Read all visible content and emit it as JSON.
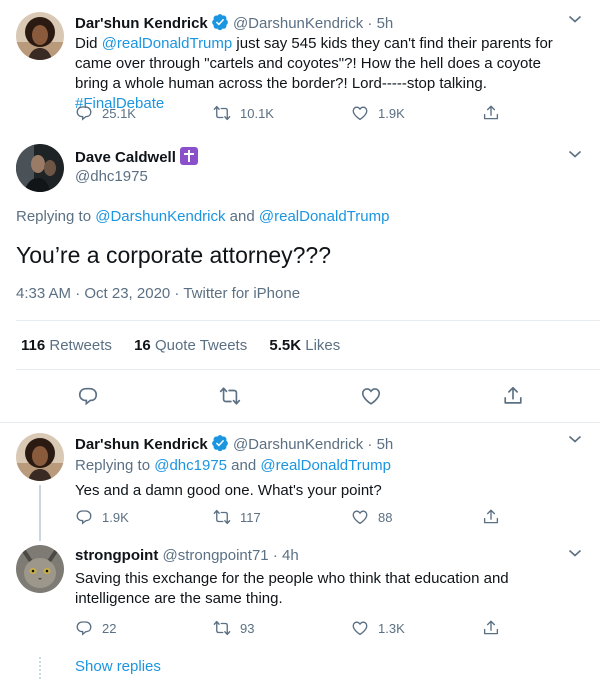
{
  "colors": {
    "link": "#1b95e0",
    "muted": "#5b7083",
    "text": "#0f1419",
    "divider": "#e6ecf0"
  },
  "tweet1": {
    "name": "Dar'shun Kendrick",
    "handle": "@DarshunKendrick",
    "time": "· 5h",
    "text_pre": "Did ",
    "mention": "@realDonaldTrump",
    "text_mid": " just say 545 kids they can't find their parents for came over through \"cartels and coyotes\"?! How the hell does a coyote bring a whole human across the border?!  Lord-----stop talking. ",
    "hashtag": "#FinalDebate",
    "replies": "25.1K",
    "retweets": "10.1K",
    "likes": "1.9K"
  },
  "main": {
    "name": "Dave Caldwell",
    "handle": "@dhc1975",
    "replying_prefix": "Replying to ",
    "replying_user1": "@DarshunKendrick",
    "replying_and": " and ",
    "replying_user2": "@realDonaldTrump",
    "text": "You’re a corporate attorney???",
    "timestamp": "4:33 AM · Oct 23, 2020 · Twitter for iPhone",
    "retweets_count": "116",
    "retweets_label": "Retweets",
    "quotes_count": "16",
    "quotes_label": "Quote Tweets",
    "likes_count": "5.5K",
    "likes_label": "Likes"
  },
  "reply1": {
    "name": "Dar'shun Kendrick",
    "handle": "@DarshunKendrick",
    "time": "· 5h",
    "replying_prefix": "Replying to ",
    "replying_user1": "@dhc1975",
    "replying_and": " and ",
    "replying_user2": "@realDonaldTrump",
    "text": "Yes and a damn good one. What's your point?",
    "replies": "1.9K",
    "retweets": "117",
    "likes": "88"
  },
  "reply2": {
    "name": "strongpoint",
    "handle": "@strongpoint71",
    "time": "· 4h",
    "text": "Saving this exchange for the people who think that education and intelligence are the same thing.",
    "replies": "22",
    "retweets": "93",
    "likes": "1.3K"
  },
  "show_replies": "Show replies"
}
